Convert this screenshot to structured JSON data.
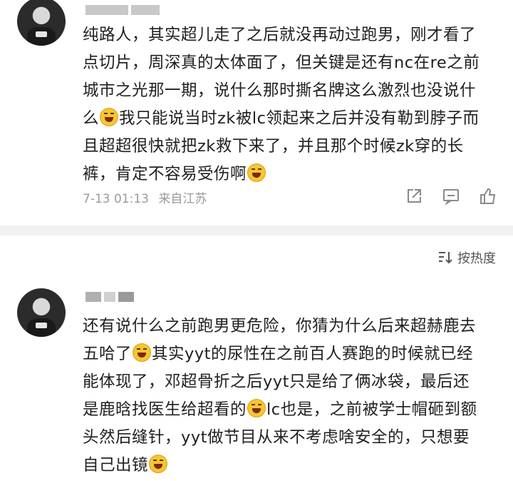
{
  "comments": [
    {
      "segments": [
        "纯路人，其实超儿走了之后就没再动过跑男，刚才看了点切片，周深真的太体面了，但关键是还有nc在re之前城市之光那一期，说什么那时撕名牌这么激烈也没说什么",
        "我只能说当时zk被lc领起来之后并没有勒到脖子而且超超很快就把zk救下来了，并且那个时候zk穿的长裤，肯定不容易受伤啊"
      ],
      "emoji": "laughing-crying-emoji",
      "time": "7-13 01:13",
      "location": "来自江苏"
    },
    {
      "segments": [
        "还有说什么之前跑男更危险，你猜为什么后来超赫鹿去五哈了",
        "其实yyt的尿性在之前百人赛跑的时候就已经能体现了，邓超骨折之后yyt只是给了俩冰袋，最后还是鹿晗找医生给超看的",
        "lc也是，之前被学士帽砸到额头然后缝针，yyt做节目从来不考虑啥安全的，只想要自己出镜"
      ],
      "emoji": "laughing-crying-emoji"
    }
  ],
  "sort_label": "按热度",
  "icons": {
    "share": "share-icon",
    "comment": "comment-icon",
    "like": "thumbs-up-icon",
    "sort": "sort-icon"
  }
}
